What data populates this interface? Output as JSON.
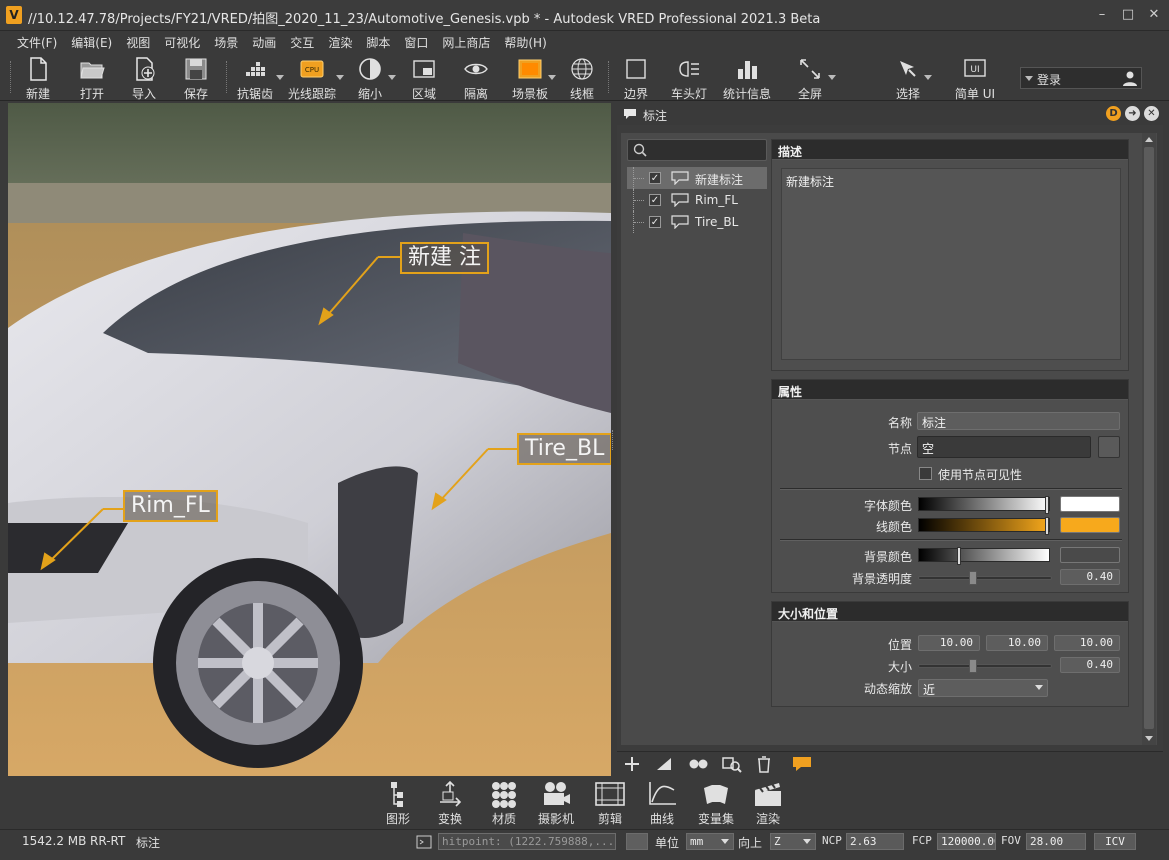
{
  "window": {
    "logo_letter": "V",
    "title": "//10.12.47.78/Projects/FY21/VRED/拍图_2020_11_23/Automotive_Genesis.vpb * - Autodesk VRED Professional 2021.3 Beta",
    "minimize": "–",
    "maximize": "□",
    "close": "✕"
  },
  "menu": [
    "文件(F)",
    "编辑(E)",
    "视图",
    "可视化",
    "场景",
    "动画",
    "交互",
    "渲染",
    "脚本",
    "窗口",
    "网上商店",
    "帮助(H)"
  ],
  "toolbar": {
    "new": "新建",
    "open": "打开",
    "import": "导入",
    "save": "保存",
    "antialias": "抗锯齿",
    "raytracing": "光线跟踪",
    "cpu_badge": "CPU",
    "zoom": "缩小",
    "region": "区域",
    "isolate": "隔离",
    "sceneplate": "场景板",
    "wireframe": "线框",
    "bounds": "边界",
    "headlight": "车头灯",
    "statistics": "统计信息",
    "fullscreen": "全屏",
    "select": "选择",
    "simple_ui": "简单 UI",
    "ui_badge": "UI",
    "login": "登录"
  },
  "viewport": {
    "annotations": [
      {
        "label": "新建 注"
      },
      {
        "label": "Tire_BL"
      },
      {
        "label": "Rim_FL"
      }
    ]
  },
  "panel": {
    "title": "标注",
    "ctrl_d": "D",
    "ctrl_next": "➜",
    "ctrl_close": "✕",
    "tree": [
      {
        "label": "新建标注",
        "checked": "✓"
      },
      {
        "label": "Rim_FL",
        "checked": "✓"
      },
      {
        "label": "Tire_BL",
        "checked": "✓"
      }
    ],
    "description": {
      "header": "描述",
      "text": "新建标注"
    },
    "properties": {
      "header": "属性",
      "name_label": "名称",
      "name_value": "标注",
      "node_label": "节点",
      "node_value": "空",
      "use_node_visibility": "使用节点可见性",
      "font_color_label": "字体颜色",
      "line_color_label": "线颜色",
      "bg_color_label": "背景颜色",
      "bg_opacity_label": "背景透明度",
      "bg_opacity_value": "0.40",
      "colors": {
        "font": "#ffffff",
        "line": "#f7a91c",
        "bg": "#4a4a4a"
      },
      "bg_opacity_level": 0.4
    },
    "size_position": {
      "header": "大小和位置",
      "position_label": "位置",
      "position": [
        "10.00",
        "10.00",
        "10.00"
      ],
      "size_label": "大小",
      "size_value": "0.40",
      "size_level": 0.4,
      "dynamic_scale_label": "动态缩放",
      "dynamic_scale_value": "近"
    }
  },
  "bottom_modules": [
    "图形",
    "变换",
    "材质",
    "摄影机",
    "剪辑",
    "曲线",
    "变量集",
    "渲染"
  ],
  "status": {
    "memory": "1542.2 MB",
    "mode": "RR-RT",
    "context": "标注",
    "hitpoint": "hitpoint: (1222.759888,...",
    "unit_label": "单位",
    "unit_value": "mm",
    "up_label": "向上",
    "up_value": "Z",
    "ncp_label": "NCP",
    "ncp_value": "2.63",
    "fcp_label": "FCP",
    "fcp_value": "120000.00",
    "fov_label": "FOV",
    "fov_value": "28.00",
    "icv": "ICV"
  }
}
